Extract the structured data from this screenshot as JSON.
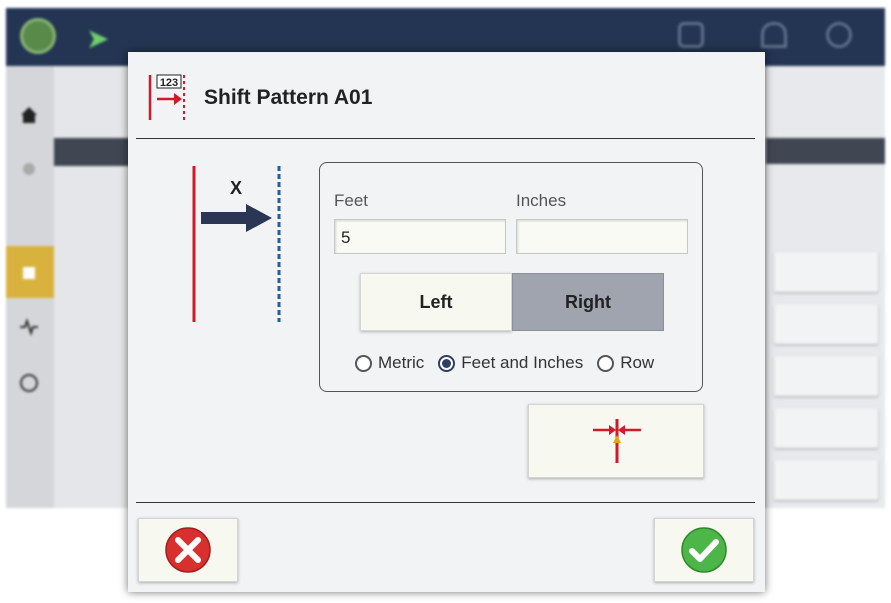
{
  "dialog": {
    "title": "Shift Pattern A01",
    "header_icon": "shift-pattern-icon",
    "header_icon_text": "123"
  },
  "diagram": {
    "label": "X",
    "line_left_color": "#d0192b",
    "line_right_color": "#1f5fa8",
    "arrow_color": "#2a3654"
  },
  "fields": {
    "feet_label": "Feet",
    "feet_value": "5",
    "inches_label": "Inches",
    "inches_value": ""
  },
  "direction": {
    "left_label": "Left",
    "right_label": "Right",
    "selected": "Right"
  },
  "units": {
    "options": [
      "Metric",
      "Feet and Inches",
      "Row"
    ],
    "selected": "Feet and Inches"
  },
  "buttons": {
    "center_icon": "center-align-icon",
    "cancel_icon": "cancel-icon",
    "confirm_icon": "confirm-check-icon"
  },
  "colors": {
    "cancel": "#d7302e",
    "confirm": "#4cb648",
    "topbar": "#233553",
    "selected_button": "#9fa4ae"
  }
}
